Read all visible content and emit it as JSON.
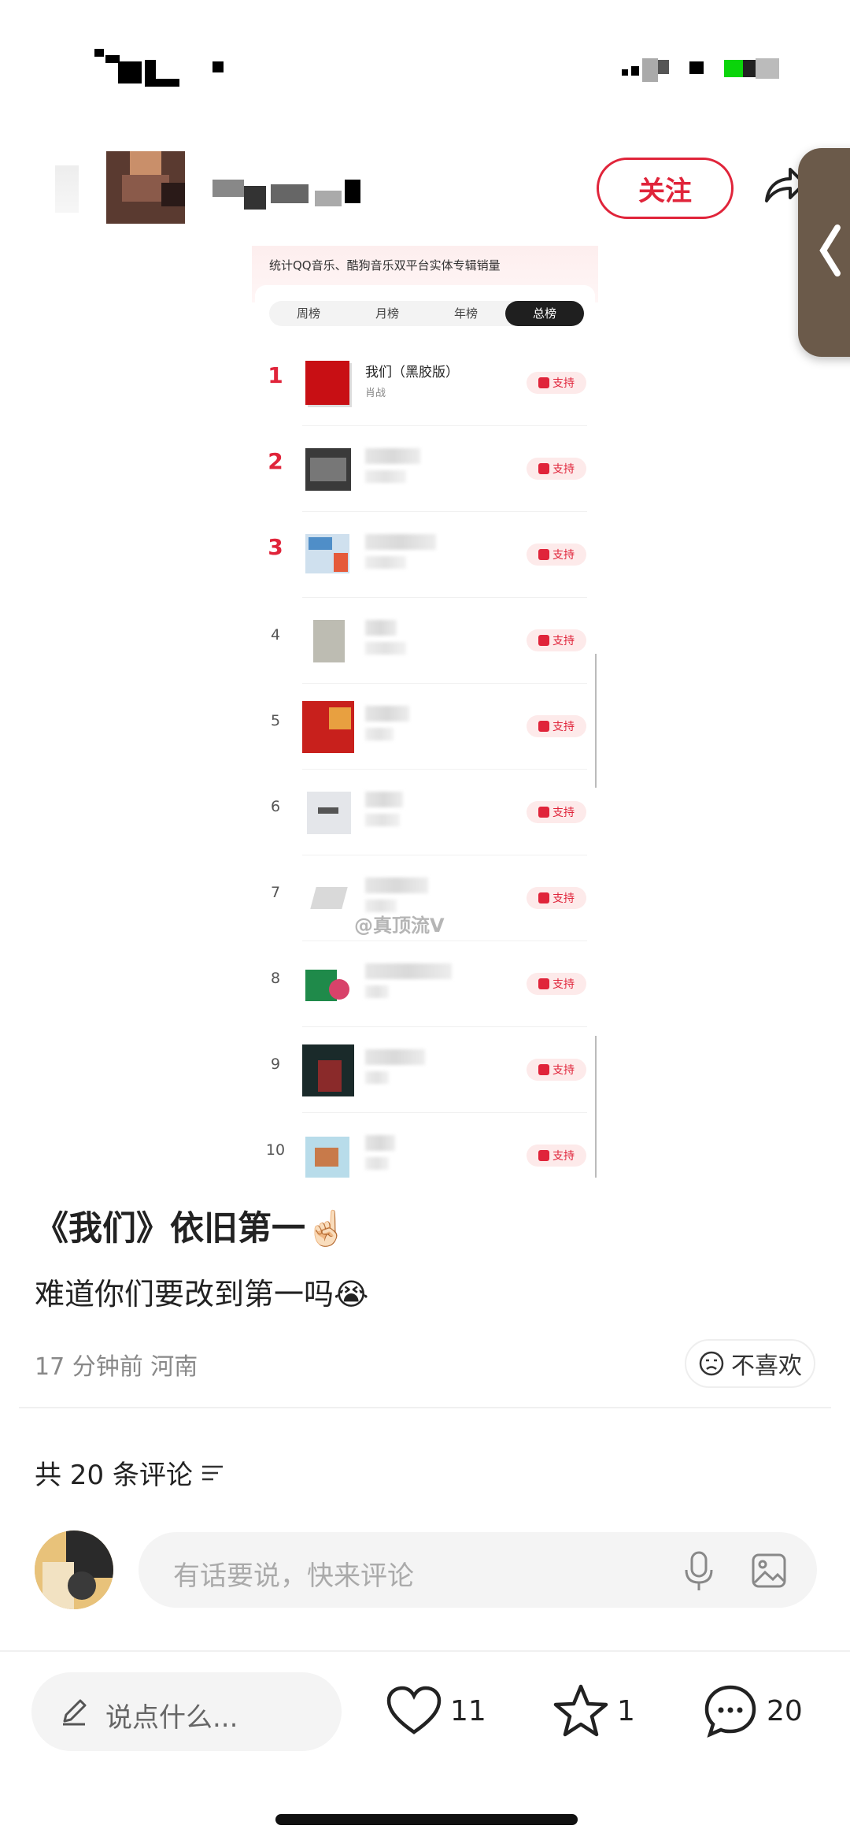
{
  "header": {
    "follow_label": "关注"
  },
  "post_image": {
    "caption": "统计QQ音乐、酷狗音乐双平台实体专辑销量",
    "tabs": [
      "周榜",
      "月榜",
      "年榜",
      "总榜"
    ],
    "active_tab": "总榜",
    "rows": [
      {
        "rank": "1",
        "title": "我们（黑胶版）",
        "artist": "肖战",
        "support": "支持"
      },
      {
        "rank": "2",
        "title": "",
        "artist": "",
        "support": "支持"
      },
      {
        "rank": "3",
        "title": "",
        "artist": "",
        "support": "支持"
      },
      {
        "rank": "4",
        "title": "",
        "artist": "",
        "support": "支持"
      },
      {
        "rank": "5",
        "title": "",
        "artist": "",
        "support": "支持"
      },
      {
        "rank": "6",
        "title": "",
        "artist": "",
        "support": "支持"
      },
      {
        "rank": "7",
        "title": "",
        "artist": "",
        "support": "支持"
      },
      {
        "rank": "8",
        "title": "",
        "artist": "",
        "support": "支持"
      },
      {
        "rank": "9",
        "title": "",
        "artist": "",
        "support": "支持"
      },
      {
        "rank": "10",
        "title": "",
        "artist": "",
        "support": "支持"
      }
    ],
    "watermark": "@真顶流V"
  },
  "post": {
    "title": "《我们》依旧第一☝🏻",
    "body": "难道你们要改到第一吗😭",
    "time": "17 分钟前",
    "location": "河南",
    "dislike_label": "不喜欢"
  },
  "comments": {
    "count_label": "共 20 条评论",
    "input_placeholder": "有话要说，快来评论"
  },
  "bottom_bar": {
    "say_placeholder": "说点什么...",
    "likes": "11",
    "stars": "1",
    "comments": "20"
  },
  "colors": {
    "accent": "#e0243a"
  }
}
